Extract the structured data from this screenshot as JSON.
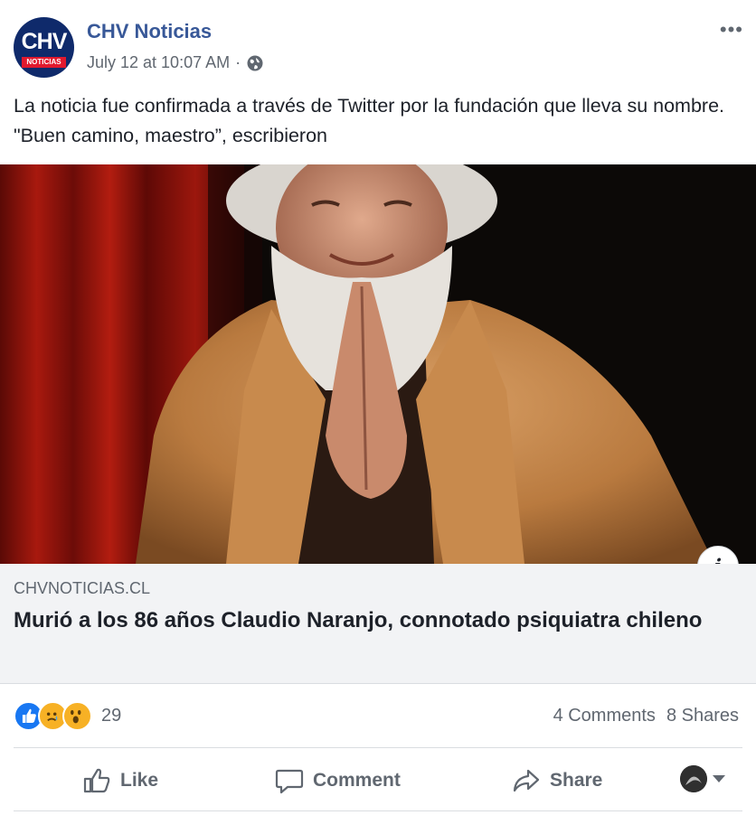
{
  "header": {
    "page_name": "CHV Noticias",
    "timestamp": "July 12 at 10:07 AM",
    "separator": "·",
    "avatar_logo": "CHV",
    "avatar_sub": "NOTICIAS",
    "more_label": "•••"
  },
  "post": {
    "text": "La noticia fue confirmada a través de Twitter por la fundación que lleva su nombre. \"Buen camino, maestro”, escribieron"
  },
  "link_preview": {
    "domain": "CHVNOTICIAS.CL",
    "title": "Murió a los 86 años Claudio Naranjo, connotado psiquiatra chileno",
    "info_label": "i"
  },
  "engagement": {
    "reactions": [
      "like-reaction-icon",
      "sad-reaction-icon",
      "wow-reaction-icon"
    ],
    "reaction_count": "29",
    "comments": "4 Comments",
    "shares": "8 Shares"
  },
  "actions": {
    "like": "Like",
    "comment": "Comment",
    "share": "Share"
  },
  "colors": {
    "brand_blue": "#385898",
    "meta_gray": "#606770",
    "link_bg": "#f2f3f5"
  }
}
